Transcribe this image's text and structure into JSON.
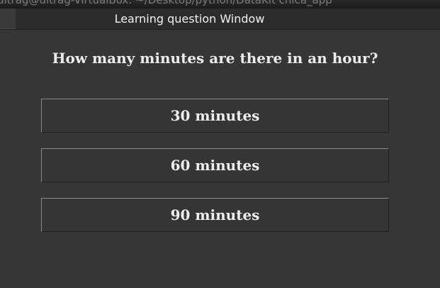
{
  "background_window": {
    "title": "ultrag@ultrag-VirtualBox: ~/Desktop/python/DataKit chica_app"
  },
  "window": {
    "title": "Learning question Window"
  },
  "question": {
    "text": "How many minutes are there in an hour?"
  },
  "answers": [
    {
      "label": "30 minutes"
    },
    {
      "label": "60 minutes"
    },
    {
      "label": "90 minutes"
    }
  ],
  "colors": {
    "background": "#363636",
    "text": "#eeeeee",
    "titlebar": "#2c2c2c"
  }
}
